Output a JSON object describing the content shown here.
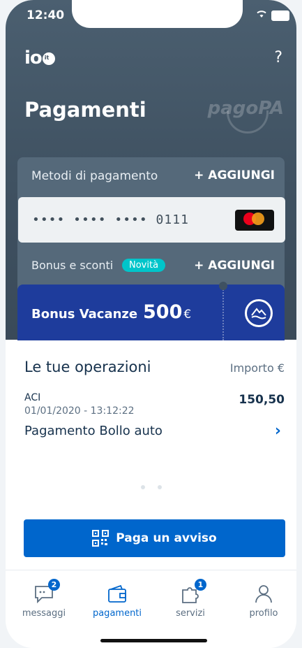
{
  "status": {
    "time": "12:40"
  },
  "header": {
    "logo": "io",
    "logo_suffix": "it",
    "help_label": "?",
    "title": "Pagamenti",
    "brand": "pagoPA"
  },
  "methods": {
    "label": "Metodi di pagamento",
    "add_label": "+ AGGIUNGI",
    "card_number": "•••• •••• •••• 0111",
    "card_brand_icon": "mastercard-icon"
  },
  "bonus": {
    "label": "Bonus e sconti",
    "badge": "Novità",
    "add_label": "+ AGGIUNGI",
    "card_title": "Bonus Vacanze",
    "card_amount": "500",
    "currency": "€"
  },
  "operations": {
    "title": "Le tue operazioni",
    "amount_header": "Importo €",
    "items": [
      {
        "merchant": "ACI",
        "date": "01/01/2020 - 13:12:22",
        "description": "Pagamento Bollo auto",
        "amount": "150,50"
      }
    ]
  },
  "pay_button": {
    "label": "Paga un avviso",
    "icon": "qr-code-icon"
  },
  "tabs": [
    {
      "label": "messaggi",
      "icon": "chat-icon",
      "badge": "2"
    },
    {
      "label": "pagamenti",
      "icon": "wallet-icon",
      "active": true
    },
    {
      "label": "servizi",
      "icon": "puzzle-icon",
      "badge": "1"
    },
    {
      "label": "profilo",
      "icon": "user-icon"
    }
  ],
  "colors": {
    "header_bg": "#3f5161",
    "accent": "#0066cc",
    "bonus_card": "#1e3c9c",
    "badge_new": "#00c5ca"
  }
}
